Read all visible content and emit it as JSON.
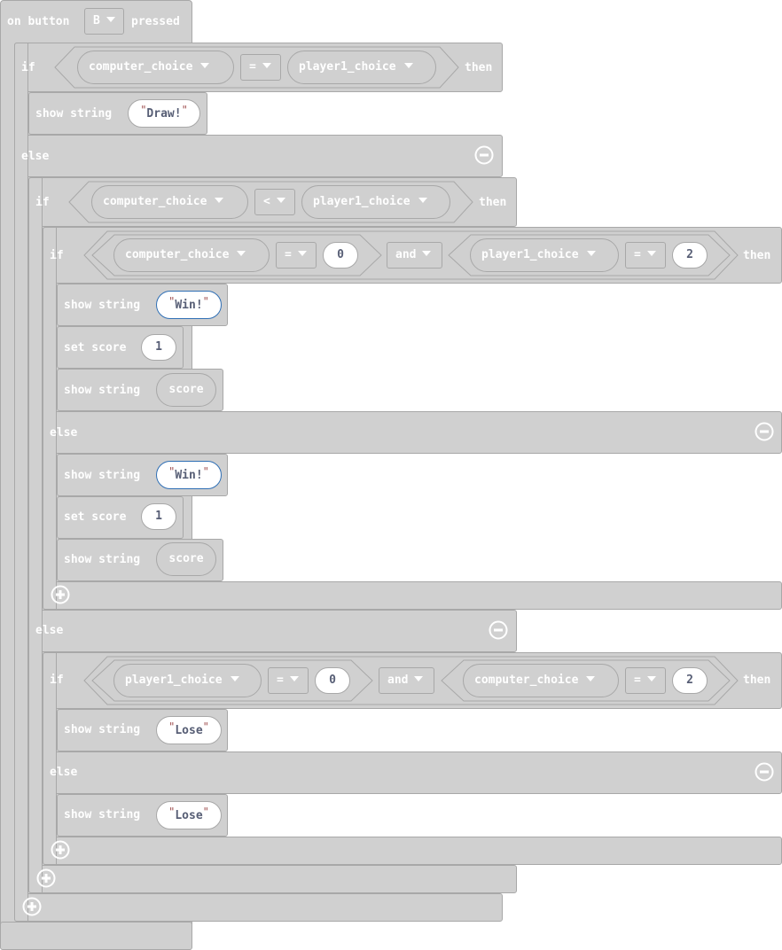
{
  "event": {
    "label_on": "on button",
    "button": "B",
    "label_pressed": "pressed"
  },
  "kw": {
    "if": "if",
    "then": "then",
    "else": "else",
    "and": "and",
    "show_string": "show string",
    "set_score": "set score"
  },
  "vars": {
    "computer_choice": "computer_choice",
    "player1_choice": "player1_choice",
    "score": "score"
  },
  "ops": {
    "eq": "=",
    "lt": "<"
  },
  "nums": {
    "zero": "0",
    "one": "1",
    "two": "2"
  },
  "strings": {
    "draw": "Draw!",
    "win": "Win!",
    "lose": "Lose"
  },
  "colors": {
    "block": "#d0d0d0",
    "border": "#a8a8a8",
    "text": "#ffffff",
    "value_text": "#575e75",
    "selected_outline": "#2f6fb5"
  }
}
